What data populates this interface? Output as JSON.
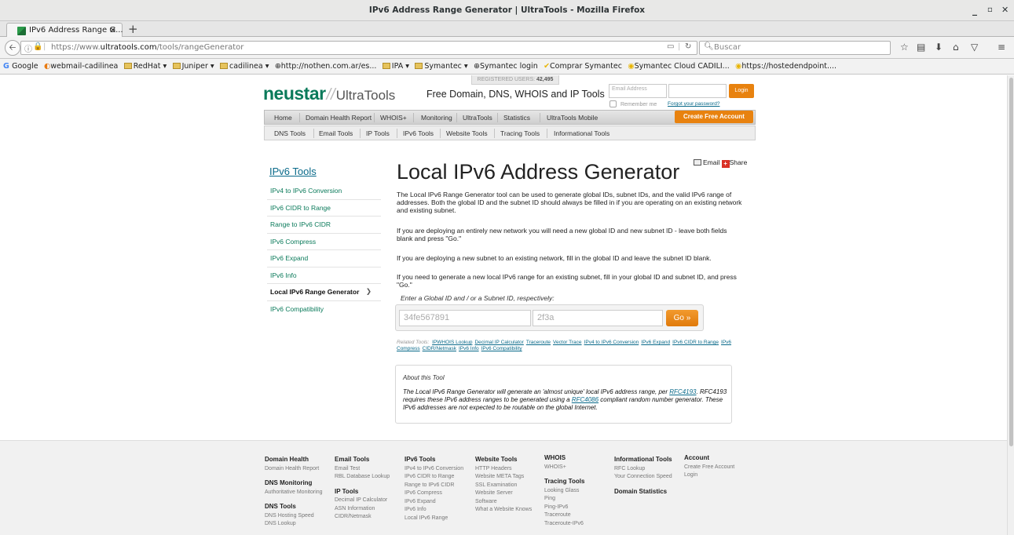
{
  "window": {
    "title": "IPv6 Address Range Generator | UltraTools - Mozilla Firefox",
    "minimize": "_",
    "maximize": "▫",
    "close": "✕"
  },
  "tab": {
    "label": "IPv6 Address Range G...",
    "close": "✕",
    "new_tab": "+"
  },
  "navbar": {
    "url_prefix": "https://www.",
    "url_domain": "ultratools.com",
    "url_path": "/tools/rangeGenerator",
    "search_placeholder": "Buscar"
  },
  "bookmarks": [
    "Google",
    "webmail-cadilinea",
    "RedHat ▾",
    "Juniper ▾",
    "cadilinea ▾",
    "http://nothen.com.ar/es...",
    "IPA ▾",
    "Symantec ▾",
    "Symantec login",
    "Comprar Symantec",
    "Symantec Cloud CADILI...",
    "https://hostedendpoint...."
  ],
  "header": {
    "registered_label": "REGISTERED USERS:",
    "registered_count": "42,495",
    "logo_brand": "neustar",
    "logo_slash": "//",
    "logo_product": "UltraTools",
    "tagline": "Free Domain, DNS, WHOIS and IP Tools",
    "email_placeholder": "Email Address",
    "login_button": "Login",
    "remember_label": "Remember me",
    "forgot_link": "Forgot your password?",
    "create_account": "Create Free Account"
  },
  "main_nav": [
    "Home",
    "Domain Health Report",
    "WHOIS+",
    "Monitoring",
    "UltraTools",
    "Statistics",
    "UltraTools Mobile"
  ],
  "sub_nav": [
    "DNS Tools",
    "Email Tools",
    "IP Tools",
    "IPv6 Tools",
    "Website Tools",
    "Tracing Tools",
    "Informational Tools"
  ],
  "sidebar": {
    "title": "IPv6 Tools",
    "items": [
      "IPv4 to IPv6 Conversion",
      "IPv6 CIDR to Range",
      "Range to IPv6 CIDR",
      "IPv6 Compress",
      "IPv6 Expand",
      "IPv6 Info",
      "Local IPv6 Range Generator",
      "IPv6 Compatibility"
    ],
    "active_chevron": "❯"
  },
  "content": {
    "email_label": "Email",
    "share_label": "Share",
    "share_glyph": "+",
    "title": "Local IPv6 Address Generator",
    "paragraphs": [
      "The Local IPv6 Range Generator tool can be used to generate global IDs, subnet IDs, and the valid IPv6 range of addresses. Both the global ID and the subnet ID should always be filled in if you are operating on an existing network and existing subnet.",
      "If you are deploying an entirely new network you will need a new global ID and new subnet ID - leave both fields blank and press \"Go.\"",
      "If you are deploying a new subnet to an existing network, fill in the global ID and leave the subnet ID blank.",
      "If you need to generate a new local IPv6 range for an existing subnet, fill in your global ID and subnet ID, and press \"Go.\""
    ],
    "prompt": "Enter a Global ID and / or a Subnet ID, respectively:",
    "global_id_placeholder": "34fe567891",
    "subnet_id_placeholder": "2f3a",
    "go_button": "Go »",
    "related_label": "Related Tools:",
    "related_links": [
      "IPWHOIS Lookup",
      "Decimal IP Calculator",
      "Traceroute",
      "Vector Trace",
      "IPv4 to IPv6 Conversion",
      "IPv6 Expand",
      "IPv6 CIDR to Range",
      "IPv6 Compress",
      "CIDR/Netmask",
      "IPv6 Info",
      "IPv6 Compatibility"
    ],
    "about_title": "About this Tool",
    "about_text_1": "The Local IPv6 Range Generator will generate an 'almost unique' local IPv6 address range, per ",
    "about_link_1": "RFC4193",
    "about_text_2": ". RFC4193 requires these IPv6 address ranges to be generated using a ",
    "about_link_2": "RFC4086",
    "about_text_3": " compliant random number generator. These IPv6 addresses are not expected to be routable on the global Internet."
  },
  "footer": {
    "domain_health": {
      "heading": "Domain Health",
      "items": [
        "Domain Health Report"
      ]
    },
    "dns_monitoring": {
      "heading": "DNS Monitoring",
      "items": [
        "Authoritative Monitoring"
      ]
    },
    "dns_tools": {
      "heading": "DNS Tools",
      "items": [
        "DNS Hosting Speed",
        "DNS Lookup"
      ]
    },
    "email_tools": {
      "heading": "Email Tools",
      "items": [
        "Email Test",
        "RBL Database Lookup"
      ]
    },
    "ip_tools": {
      "heading": "IP Tools",
      "items": [
        "Decimal IP Calculator",
        "ASN Information",
        "CIDR/Netmask"
      ]
    },
    "ipv6_tools": {
      "heading": "IPv6 Tools",
      "items": [
        "IPv4 to IPv6 Conversion",
        "IPv6 CIDR to Range",
        "Range to IPv6 CIDR",
        "IPv6 Compress",
        "IPv6 Expand",
        "IPv6 Info",
        "Local IPv6 Range"
      ]
    },
    "website_tools": {
      "heading": "Website Tools",
      "items": [
        "HTTP Headers",
        "Website META Tags",
        "SSL Examination",
        "Website Server",
        "Software",
        "What a Website Knows"
      ]
    },
    "whois": {
      "heading": "WHOIS",
      "items": [
        "WHOIS+"
      ]
    },
    "tracing_tools": {
      "heading": "Tracing Tools",
      "items": [
        "Looking Glass",
        "Ping",
        "Ping-IPv6",
        "Traceroute",
        "Traceroute-IPv6"
      ]
    },
    "informational_tools": {
      "heading": "Informational Tools",
      "items": [
        "RFC Lookup",
        "Your Connection Speed"
      ]
    },
    "domain_statistics": {
      "heading": "Domain Statistics",
      "items": []
    },
    "account": {
      "heading": "Account",
      "items": [
        "Create Free Account",
        "Login"
      ]
    }
  }
}
